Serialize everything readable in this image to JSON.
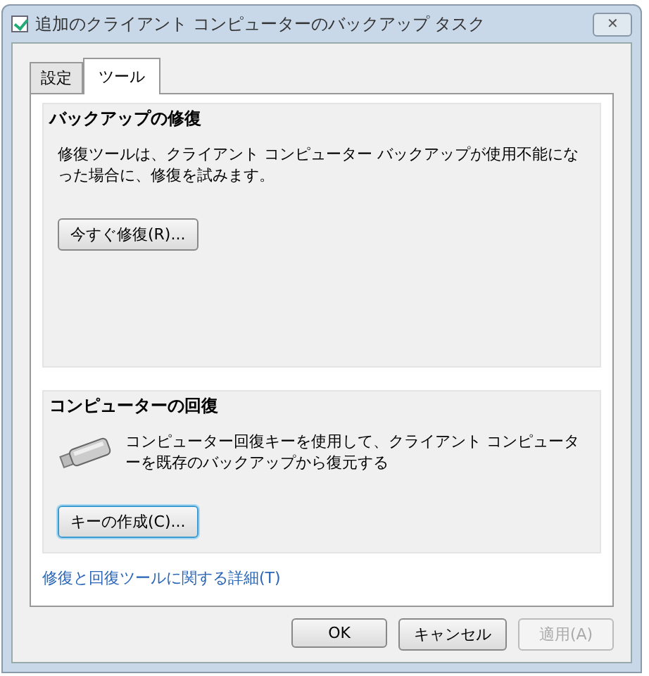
{
  "window": {
    "title": "追加のクライアント コンピューターのバックアップ タスク",
    "checked": true,
    "close": "✕"
  },
  "tabs": [
    {
      "label": "設定",
      "selected": false
    },
    {
      "label": "ツール",
      "selected": true
    }
  ],
  "sections": [
    {
      "heading": "バックアップの修復",
      "text": "修復ツールは、クライアント コンピューター バックアップが使用不能になった場合に、修復を試みます。",
      "button": "今すぐ修復(R)...",
      "kind": "plain"
    },
    {
      "heading": "コンピューターの回復",
      "text": "コンピューター回復キーを使用して、クライアント コンピューターを既存のバックアップから復元する",
      "button": "キーの作成(C)...",
      "kind": "usb"
    }
  ],
  "link": "修復と回復ツールに関する詳細(T)",
  "buttons": [
    {
      "label": "OK",
      "disabled": false
    },
    {
      "label": "キャンセル",
      "disabled": false
    },
    {
      "label": "適用(A)",
      "disabled": true
    }
  ]
}
